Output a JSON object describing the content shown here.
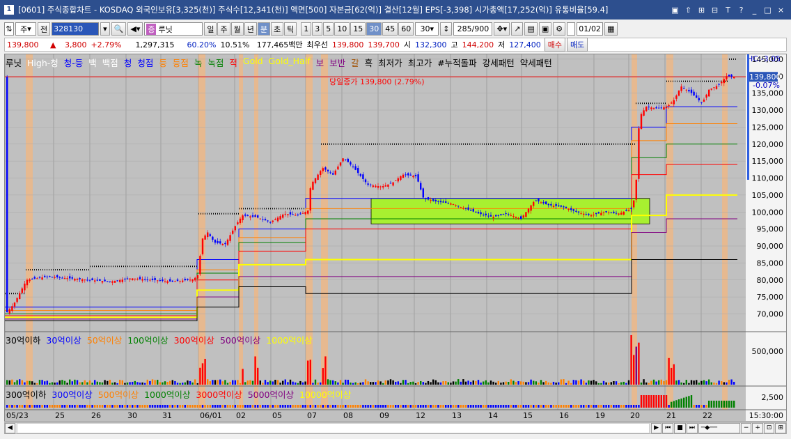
{
  "titlebar": {
    "number": "1",
    "text": "[0601] 주식종합차트 - KOSDAQ 외국인보유[3,325(천)] 주식수[12,341(천)] 액면[500] 자본금[62(억)] 결산[12월] EPS[-3,398] 시가총액[17,252(억)] 유통비율[59.4]",
    "buttons": [
      "▣",
      "⇧",
      "⊞",
      "⊟",
      "T",
      "?",
      "_",
      "□",
      "×"
    ]
  },
  "toolbar": {
    "period_sel": "주",
    "view_label": "전",
    "code": "328130",
    "name": "루닛",
    "intervals": [
      "일",
      "주",
      "월",
      "년",
      "분",
      "초",
      "틱"
    ],
    "active_interval": "분",
    "numbers": [
      "1",
      "3",
      "5",
      "10",
      "15",
      "30",
      "45",
      "60"
    ],
    "active_number": "30",
    "count_value": "30",
    "range_value": "285/900",
    "date_value": "01/02"
  },
  "info": {
    "price": "139,800",
    "arrow": "▲",
    "change": "3,800",
    "pct": "+2.79%",
    "volume": "1,297,315",
    "ratio1": "60.20%",
    "ratio2": "10.51%",
    "amount": "177,465백만",
    "best_label": "최우선",
    "best_ask": "139,800",
    "best_bid": "139,700",
    "open_label": "시",
    "open": "132,300",
    "high_label": "고",
    "high": "144,200",
    "low_label": "저",
    "low": "127,400",
    "buy_label": "매수",
    "sell_label": "매도"
  },
  "legend": [
    {
      "text": "루닛",
      "color": "#000000"
    },
    {
      "text": "High-청",
      "color": "#ffffff"
    },
    {
      "text": "청-등",
      "color": "#0000ff"
    },
    {
      "text": "백",
      "color": "#ffffff"
    },
    {
      "text": "백점",
      "color": "#ffffff"
    },
    {
      "text": "청",
      "color": "#0000ff"
    },
    {
      "text": "청점",
      "color": "#0000ff"
    },
    {
      "text": "등",
      "color": "#ff8000"
    },
    {
      "text": "등점",
      "color": "#ff8000"
    },
    {
      "text": "녹",
      "color": "#008000"
    },
    {
      "text": "녹점",
      "color": "#008000"
    },
    {
      "text": "적",
      "color": "#ff0000"
    },
    {
      "text": "Gold",
      "color": "#ffff00"
    },
    {
      "text": "Gold_Half",
      "color": "#ffff00"
    },
    {
      "text": "보",
      "color": "#800080"
    },
    {
      "text": "보반",
      "color": "#800080"
    },
    {
      "text": "갈",
      "color": "#a05000"
    },
    {
      "text": "흑",
      "color": "#000000"
    },
    {
      "text": "최저가",
      "color": "#000000"
    },
    {
      "text": "최고가",
      "color": "#000000"
    },
    {
      "text": "#누적돌파",
      "color": "#000000"
    },
    {
      "text": "강세패턴",
      "color": "#000000"
    },
    {
      "text": "약세패턴",
      "color": "#000000"
    }
  ],
  "close_annotation": "당일종가 139,800 (2.79%)",
  "price_axis": {
    "labels": [
      "145,000",
      "140,000",
      "135,000",
      "130,000",
      "125,000",
      "120,000",
      "115,000",
      "110,000",
      "105,000",
      "100,000",
      "95,000",
      "90,000",
      "85,000",
      "80,000",
      "75,000",
      "70,000"
    ],
    "values": [
      145000,
      140000,
      135000,
      130000,
      125000,
      120000,
      115000,
      110000,
      105000,
      100000,
      95000,
      90000,
      85000,
      80000,
      75000,
      70000
    ],
    "current": "139,800",
    "current_value": 139800,
    "hc": "HC:-3.05",
    "pct": "-0.07%"
  },
  "volume_legend": [
    {
      "text": "30억이하",
      "color": "#000000"
    },
    {
      "text": "30억이상",
      "color": "#0000ff"
    },
    {
      "text": "50억이상",
      "color": "#ff8000"
    },
    {
      "text": "100억이상",
      "color": "#008000"
    },
    {
      "text": "300억이상",
      "color": "#ff0000"
    },
    {
      "text": "500억이상",
      "color": "#800080"
    },
    {
      "text": "1000억이상",
      "color": "#ffff00"
    }
  ],
  "volume_axis": {
    "label": "500,000",
    "value": 500000
  },
  "amount_legend": [
    {
      "text": "300억이하",
      "color": "#000000"
    },
    {
      "text": "300억이상",
      "color": "#0000ff"
    },
    {
      "text": "500억이상",
      "color": "#ff8000"
    },
    {
      "text": "1000억이상",
      "color": "#008000"
    },
    {
      "text": "3000억이상",
      "color": "#ff0000"
    },
    {
      "text": "5000억이상",
      "color": "#800080"
    },
    {
      "text": "10000억이상",
      "color": "#ffff00"
    }
  ],
  "amount_axis": {
    "label": "2,500",
    "value": 2500
  },
  "dates": [
    "05/23",
    "25",
    "26",
    "30",
    "31",
    "06/01",
    "02",
    "05",
    "07",
    "08",
    "09",
    "12",
    "13",
    "14",
    "15",
    "16",
    "19",
    "20",
    "21",
    "22"
  ],
  "time_label": "15:30:00",
  "chart_data": {
    "type": "candlestick",
    "ylim": [
      66000,
      146000
    ],
    "price_path": [
      [
        0,
        70000
      ],
      [
        12,
        73000
      ],
      [
        30,
        80000
      ],
      [
        60,
        81000
      ],
      [
        90,
        80500
      ],
      [
        120,
        80000
      ],
      [
        150,
        79500
      ],
      [
        180,
        80500
      ],
      [
        210,
        80000
      ],
      [
        240,
        79500
      ],
      [
        270,
        80200
      ],
      [
        276,
        81500
      ],
      [
        282,
        92000
      ],
      [
        290,
        94000
      ],
      [
        300,
        91000
      ],
      [
        315,
        90500
      ],
      [
        330,
        96000
      ],
      [
        340,
        99000
      ],
      [
        360,
        98500
      ],
      [
        380,
        97000
      ],
      [
        400,
        99500
      ],
      [
        420,
        99000
      ],
      [
        435,
        100500
      ],
      [
        438,
        108000
      ],
      [
        445,
        110000
      ],
      [
        455,
        113000
      ],
      [
        470,
        111000
      ],
      [
        485,
        116000
      ],
      [
        500,
        113000
      ],
      [
        520,
        108000
      ],
      [
        540,
        107500
      ],
      [
        555,
        108500
      ],
      [
        570,
        111000
      ],
      [
        590,
        110500
      ],
      [
        600,
        104000
      ],
      [
        620,
        103000
      ],
      [
        640,
        102500
      ],
      [
        660,
        101000
      ],
      [
        680,
        99500
      ],
      [
        700,
        98500
      ],
      [
        720,
        99500
      ],
      [
        740,
        98000
      ],
      [
        760,
        103500
      ],
      [
        780,
        102000
      ],
      [
        800,
        101500
      ],
      [
        820,
        100000
      ],
      [
        840,
        99000
      ],
      [
        860,
        100000
      ],
      [
        880,
        99500
      ],
      [
        900,
        101000
      ],
      [
        905,
        107000
      ],
      [
        910,
        128000
      ],
      [
        920,
        131000
      ],
      [
        935,
        130500
      ],
      [
        950,
        131000
      ],
      [
        960,
        133000
      ],
      [
        970,
        137000
      ],
      [
        985,
        135000
      ],
      [
        1000,
        132000
      ],
      [
        1010,
        136000
      ],
      [
        1025,
        137500
      ],
      [
        1035,
        140000
      ],
      [
        1045,
        139800
      ]
    ]
  }
}
